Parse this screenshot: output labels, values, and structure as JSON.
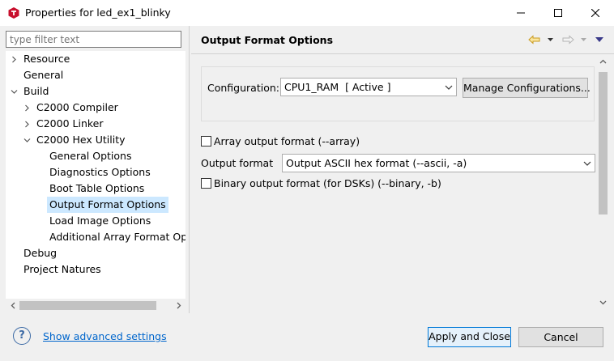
{
  "window": {
    "title": "Properties for led_ex1_blinky"
  },
  "filter": {
    "placeholder": "type filter text"
  },
  "tree": {
    "resource": "Resource",
    "general": "General",
    "build": "Build",
    "c2000_compiler": "C2000 Compiler",
    "c2000_linker": "C2000 Linker",
    "c2000_hex_utility": "C2000 Hex Utility",
    "general_options": "General Options",
    "diagnostics_options": "Diagnostics Options",
    "boot_table_options": "Boot Table Options",
    "output_format_options": "Output Format Options",
    "load_image_options": "Load Image Options",
    "additional_array_format": "Additional Array Format Opt",
    "debug": "Debug",
    "project_natures": "Project Natures",
    "selected": "Output Format Options"
  },
  "page": {
    "title": "Output Format Options"
  },
  "configuration": {
    "label": "Configuration:",
    "value": "CPU1_RAM  [ Active ]",
    "manage_button": "Manage Configurations..."
  },
  "options": {
    "array_output_label": "Array output format (--array)",
    "array_output_checked": false,
    "output_format_label": "Output format",
    "output_format_value": "Output ASCII hex format (--ascii, -a)",
    "binary_output_label": "Binary output format (for DSKs) (--binary, -b)",
    "binary_output_checked": false
  },
  "footer": {
    "advanced_link": "Show advanced settings",
    "apply_close": "Apply and Close",
    "cancel": "Cancel",
    "help_glyph": "?"
  },
  "colors": {
    "selection": "#cce8ff",
    "accent": "#0078d7",
    "link": "#0066cc",
    "app_icon": "#c8102e"
  },
  "icons": {
    "app": "ti-chip-icon",
    "back": "back-arrow-icon",
    "forward": "forward-arrow-icon",
    "menu": "view-menu-icon"
  }
}
